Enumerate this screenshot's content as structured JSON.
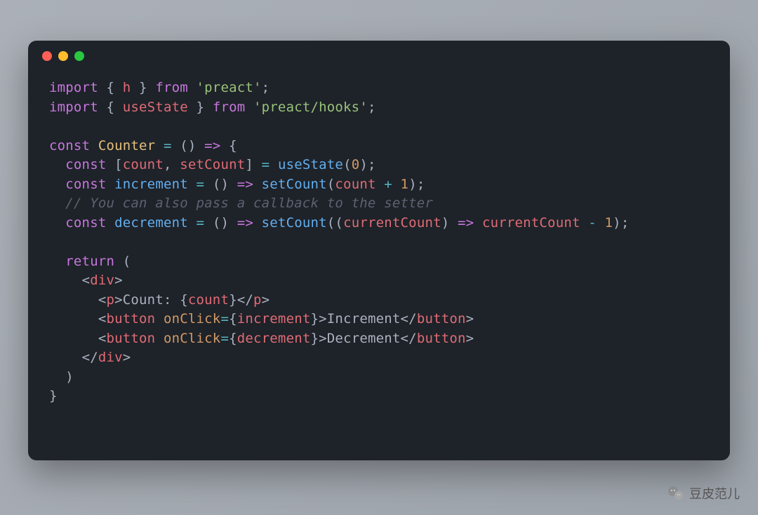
{
  "window": {
    "traffic_lights": [
      "close",
      "minimize",
      "zoom"
    ]
  },
  "code": {
    "l1": {
      "kw1": "import",
      "brace1": "{ ",
      "id": "h",
      "brace2": " }",
      "kw2": "from",
      "str": "'preact'",
      "semi": ";"
    },
    "l2": {
      "kw1": "import",
      "brace1": "{ ",
      "id": "useState",
      "brace2": " }",
      "kw2": "from",
      "str": "'preact/hooks'",
      "semi": ";"
    },
    "l3": "",
    "l4": {
      "kw": "const",
      "name": "Counter",
      "eq": " = ",
      "paren": "()",
      "arrow": " => ",
      "brace": "{"
    },
    "l5": {
      "indent": "  ",
      "kw": "const",
      "bracket1": " [",
      "a": "count",
      "comma": ", ",
      "b": "setCount",
      "bracket2": "] ",
      "eq": "= ",
      "fn": "useState",
      "open": "(",
      "num": "0",
      "close": ")",
      "semi": ";"
    },
    "l6": {
      "indent": "  ",
      "kw": "const",
      "name": "increment",
      "eq": " = ",
      "paren": "()",
      "arrow": " => ",
      "fn": "setCount",
      "open": "(",
      "arg": "count",
      "plus": " + ",
      "num": "1",
      "close": ")",
      "semi": ";"
    },
    "l7": {
      "indent": "  ",
      "cmt": "// You can also pass a callback to the setter"
    },
    "l8": {
      "indent": "  ",
      "kw": "const",
      "name": "decrement",
      "eq": " = ",
      "paren": "()",
      "arrow": " => ",
      "fn": "setCount",
      "open": "(",
      "p1": "(",
      "arg": "currentCount",
      "p2": ")",
      "arrow2": " => ",
      "arg2": "currentCount",
      "minus": " - ",
      "num": "1",
      "close": ")",
      "semi": ";"
    },
    "l9": "",
    "l10": {
      "indent": "  ",
      "kw": "return",
      "paren": " ("
    },
    "l11": {
      "indent": "    ",
      "lt": "<",
      "tag": "div",
      "gt": ">"
    },
    "l12": {
      "indent": "      ",
      "lt": "<",
      "tag": "p",
      "gt": ">",
      "text": "Count: ",
      "open": "{",
      "var": "count",
      "close": "}",
      "lt2": "</",
      "tag2": "p",
      "gt2": ">"
    },
    "l13": {
      "indent": "      ",
      "lt": "<",
      "tag": "button",
      "sp": " ",
      "attr": "onClick",
      "eq": "=",
      "open": "{",
      "val": "increment",
      "close": "}",
      "gt": ">",
      "text": "Increment",
      "lt2": "</",
      "tag2": "button",
      "gt2": ">"
    },
    "l14": {
      "indent": "      ",
      "lt": "<",
      "tag": "button",
      "sp": " ",
      "attr": "onClick",
      "eq": "=",
      "open": "{",
      "val": "decrement",
      "close": "}",
      "gt": ">",
      "text": "Decrement",
      "lt2": "</",
      "tag2": "button",
      "gt2": ">"
    },
    "l15": {
      "indent": "    ",
      "lt": "</",
      "tag": "div",
      "gt": ">"
    },
    "l16": {
      "indent": "  ",
      "paren": ")"
    },
    "l17": {
      "brace": "}"
    }
  },
  "watermark": {
    "text": "豆皮范儿"
  }
}
